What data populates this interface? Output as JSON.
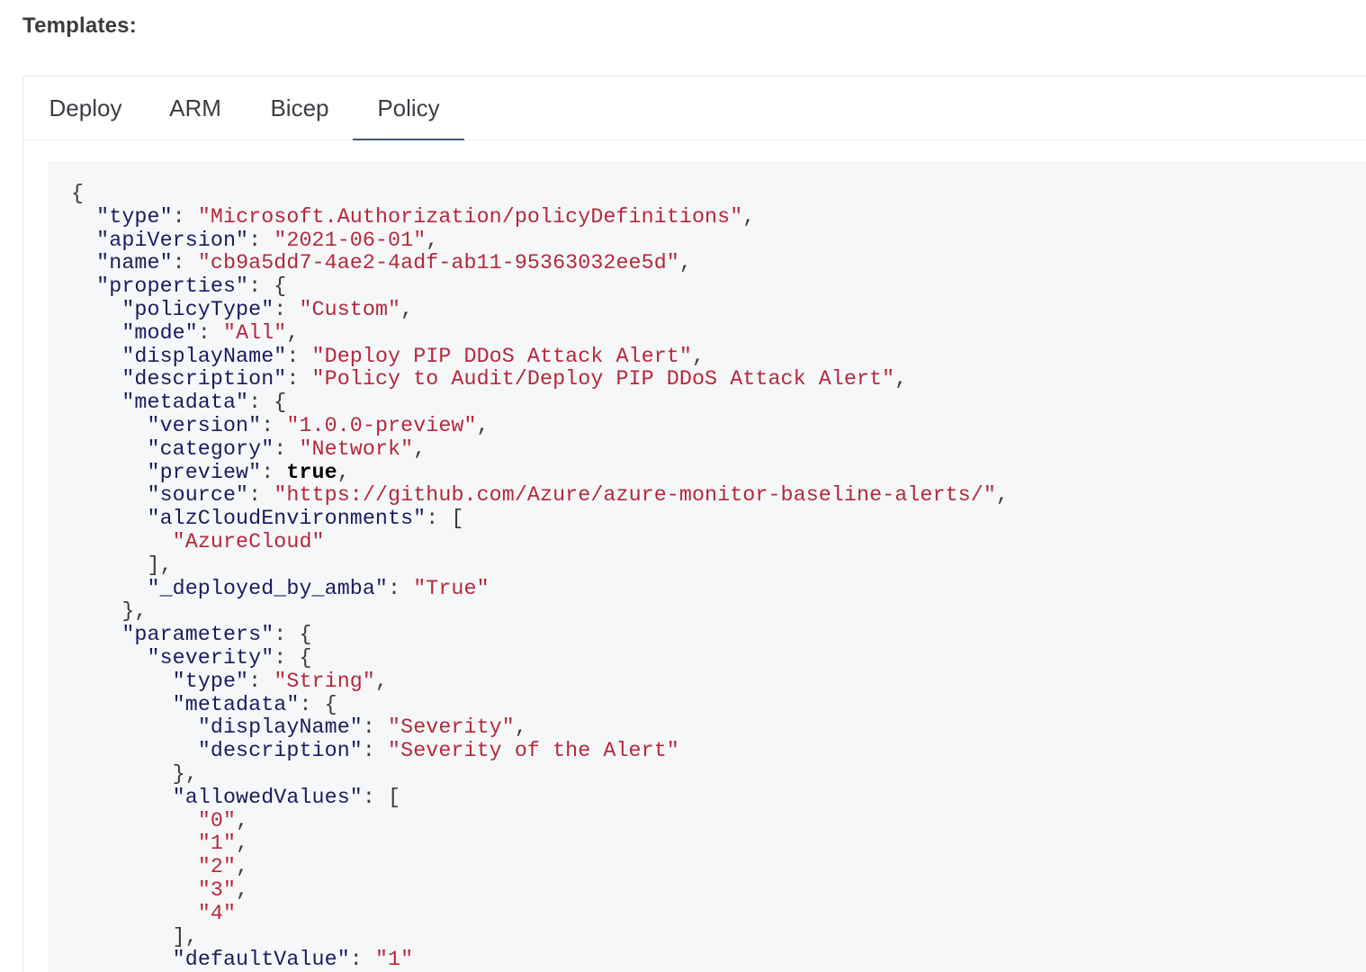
{
  "heading": "Templates:",
  "tabs": [
    {
      "label": "Deploy",
      "active": false
    },
    {
      "label": "ARM",
      "active": false
    },
    {
      "label": "Bicep",
      "active": false
    },
    {
      "label": "Policy",
      "active": true
    }
  ],
  "colors": {
    "active_tab_underline": "#3b5a7a",
    "json_key": "#1a1c5e",
    "json_string": "#b4283c",
    "json_boolean": "#000000",
    "code_background": "#f6f7f9"
  },
  "code": {
    "language": "json",
    "lines": [
      [
        {
          "t": "{",
          "k": "punc"
        }
      ],
      [
        {
          "t": "  "
        },
        {
          "t": "\"type\"",
          "k": "key"
        },
        {
          "t": ": ",
          "k": "punc"
        },
        {
          "t": "\"Microsoft.Authorization/policyDefinitions\"",
          "k": "str"
        },
        {
          "t": ",",
          "k": "punc"
        }
      ],
      [
        {
          "t": "  "
        },
        {
          "t": "\"apiVersion\"",
          "k": "key"
        },
        {
          "t": ": ",
          "k": "punc"
        },
        {
          "t": "\"2021-06-01\"",
          "k": "str"
        },
        {
          "t": ",",
          "k": "punc"
        }
      ],
      [
        {
          "t": "  "
        },
        {
          "t": "\"name\"",
          "k": "key"
        },
        {
          "t": ": ",
          "k": "punc"
        },
        {
          "t": "\"cb9a5dd7-4ae2-4adf-ab11-95363032ee5d\"",
          "k": "str"
        },
        {
          "t": ",",
          "k": "punc"
        }
      ],
      [
        {
          "t": "  "
        },
        {
          "t": "\"properties\"",
          "k": "key"
        },
        {
          "t": ": {",
          "k": "punc"
        }
      ],
      [
        {
          "t": "    "
        },
        {
          "t": "\"policyType\"",
          "k": "key"
        },
        {
          "t": ": ",
          "k": "punc"
        },
        {
          "t": "\"Custom\"",
          "k": "str"
        },
        {
          "t": ",",
          "k": "punc"
        }
      ],
      [
        {
          "t": "    "
        },
        {
          "t": "\"mode\"",
          "k": "key"
        },
        {
          "t": ": ",
          "k": "punc"
        },
        {
          "t": "\"All\"",
          "k": "str"
        },
        {
          "t": ",",
          "k": "punc"
        }
      ],
      [
        {
          "t": "    "
        },
        {
          "t": "\"displayName\"",
          "k": "key"
        },
        {
          "t": ": ",
          "k": "punc"
        },
        {
          "t": "\"Deploy PIP DDoS Attack Alert\"",
          "k": "str"
        },
        {
          "t": ",",
          "k": "punc"
        }
      ],
      [
        {
          "t": "    "
        },
        {
          "t": "\"description\"",
          "k": "key"
        },
        {
          "t": ": ",
          "k": "punc"
        },
        {
          "t": "\"Policy to Audit/Deploy PIP DDoS Attack Alert\"",
          "k": "str"
        },
        {
          "t": ",",
          "k": "punc"
        }
      ],
      [
        {
          "t": "    "
        },
        {
          "t": "\"metadata\"",
          "k": "key"
        },
        {
          "t": ": {",
          "k": "punc"
        }
      ],
      [
        {
          "t": "      "
        },
        {
          "t": "\"version\"",
          "k": "key"
        },
        {
          "t": ": ",
          "k": "punc"
        },
        {
          "t": "\"1.0.0-preview\"",
          "k": "str"
        },
        {
          "t": ",",
          "k": "punc"
        }
      ],
      [
        {
          "t": "      "
        },
        {
          "t": "\"category\"",
          "k": "key"
        },
        {
          "t": ": ",
          "k": "punc"
        },
        {
          "t": "\"Network\"",
          "k": "str"
        },
        {
          "t": ",",
          "k": "punc"
        }
      ],
      [
        {
          "t": "      "
        },
        {
          "t": "\"preview\"",
          "k": "key"
        },
        {
          "t": ": ",
          "k": "punc"
        },
        {
          "t": "true",
          "k": "bool"
        },
        {
          "t": ",",
          "k": "punc"
        }
      ],
      [
        {
          "t": "      "
        },
        {
          "t": "\"source\"",
          "k": "key"
        },
        {
          "t": ": ",
          "k": "punc"
        },
        {
          "t": "\"https://github.com/Azure/azure-monitor-baseline-alerts/\"",
          "k": "str"
        },
        {
          "t": ",",
          "k": "punc"
        }
      ],
      [
        {
          "t": "      "
        },
        {
          "t": "\"alzCloudEnvironments\"",
          "k": "key"
        },
        {
          "t": ": [",
          "k": "punc"
        }
      ],
      [
        {
          "t": "        "
        },
        {
          "t": "\"AzureCloud\"",
          "k": "str"
        }
      ],
      [
        {
          "t": "      "
        },
        {
          "t": "],",
          "k": "punc"
        }
      ],
      [
        {
          "t": "      "
        },
        {
          "t": "\"_deployed_by_amba\"",
          "k": "key"
        },
        {
          "t": ": ",
          "k": "punc"
        },
        {
          "t": "\"True\"",
          "k": "str"
        }
      ],
      [
        {
          "t": "    "
        },
        {
          "t": "},",
          "k": "punc"
        }
      ],
      [
        {
          "t": "    "
        },
        {
          "t": "\"parameters\"",
          "k": "key"
        },
        {
          "t": ": {",
          "k": "punc"
        }
      ],
      [
        {
          "t": "      "
        },
        {
          "t": "\"severity\"",
          "k": "key"
        },
        {
          "t": ": {",
          "k": "punc"
        }
      ],
      [
        {
          "t": "        "
        },
        {
          "t": "\"type\"",
          "k": "key"
        },
        {
          "t": ": ",
          "k": "punc"
        },
        {
          "t": "\"String\"",
          "k": "str"
        },
        {
          "t": ",",
          "k": "punc"
        }
      ],
      [
        {
          "t": "        "
        },
        {
          "t": "\"metadata\"",
          "k": "key"
        },
        {
          "t": ": {",
          "k": "punc"
        }
      ],
      [
        {
          "t": "          "
        },
        {
          "t": "\"displayName\"",
          "k": "key"
        },
        {
          "t": ": ",
          "k": "punc"
        },
        {
          "t": "\"Severity\"",
          "k": "str"
        },
        {
          "t": ",",
          "k": "punc"
        }
      ],
      [
        {
          "t": "          "
        },
        {
          "t": "\"description\"",
          "k": "key"
        },
        {
          "t": ": ",
          "k": "punc"
        },
        {
          "t": "\"Severity of the Alert\"",
          "k": "str"
        }
      ],
      [
        {
          "t": "        "
        },
        {
          "t": "},",
          "k": "punc"
        }
      ],
      [
        {
          "t": "        "
        },
        {
          "t": "\"allowedValues\"",
          "k": "key"
        },
        {
          "t": ": [",
          "k": "punc"
        }
      ],
      [
        {
          "t": "          "
        },
        {
          "t": "\"0\"",
          "k": "str"
        },
        {
          "t": ",",
          "k": "punc"
        }
      ],
      [
        {
          "t": "          "
        },
        {
          "t": "\"1\"",
          "k": "str"
        },
        {
          "t": ",",
          "k": "punc"
        }
      ],
      [
        {
          "t": "          "
        },
        {
          "t": "\"2\"",
          "k": "str"
        },
        {
          "t": ",",
          "k": "punc"
        }
      ],
      [
        {
          "t": "          "
        },
        {
          "t": "\"3\"",
          "k": "str"
        },
        {
          "t": ",",
          "k": "punc"
        }
      ],
      [
        {
          "t": "          "
        },
        {
          "t": "\"4\"",
          "k": "str"
        }
      ],
      [
        {
          "t": "        "
        },
        {
          "t": "],",
          "k": "punc"
        }
      ],
      [
        {
          "t": "        "
        },
        {
          "t": "\"defaultValue\"",
          "k": "key"
        },
        {
          "t": ": ",
          "k": "punc"
        },
        {
          "t": "\"1\"",
          "k": "str"
        }
      ]
    ]
  }
}
